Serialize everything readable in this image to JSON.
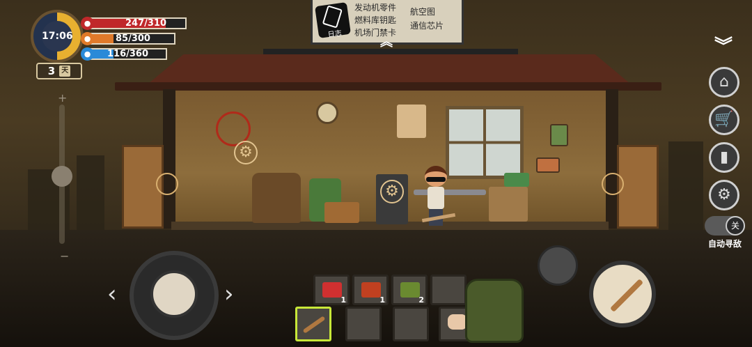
{
  "hud": {
    "time": "17:06",
    "day_number": "3",
    "day_unit": "天",
    "health": {
      "text": "247/310",
      "current": 247,
      "max": 310,
      "color": "#c0282a"
    },
    "hunger": {
      "text": "85/300",
      "current": 85,
      "max": 300,
      "color": "#e07a2a"
    },
    "water": {
      "text": "116/360",
      "current": 116,
      "max": 360,
      "color": "#2a8ad8"
    }
  },
  "log_panel": {
    "icon_label": "日志",
    "items": [
      "发动机零件",
      "燃料库钥匙",
      "机场门禁卡",
      "航空图",
      "通信芯片"
    ]
  },
  "side_menu": {
    "buttons": [
      "home-icon",
      "cart-icon",
      "skills-icon",
      "gear-icon"
    ],
    "toggle_state": "关",
    "toggle_label": "自动寻敌"
  },
  "controls": {
    "left_arrow": "‹",
    "right_arrow": "›"
  },
  "inventory": {
    "top_row": [
      {
        "item": "medkit-icon",
        "qty": "1",
        "color": "#d03030"
      },
      {
        "item": "medicine-box-icon",
        "qty": "1",
        "color": "#c04020"
      },
      {
        "item": "herbs-icon",
        "qty": "2",
        "color": "#6a8a30"
      },
      {
        "item": "empty",
        "qty": "",
        "color": ""
      }
    ],
    "bottom_row": [
      {
        "item": "wooden-bat-icon",
        "qty": "",
        "selected": true
      },
      {
        "item": "empty",
        "qty": ""
      },
      {
        "item": "empty",
        "qty": ""
      },
      {
        "item": "fist-icon",
        "qty": ""
      }
    ]
  }
}
